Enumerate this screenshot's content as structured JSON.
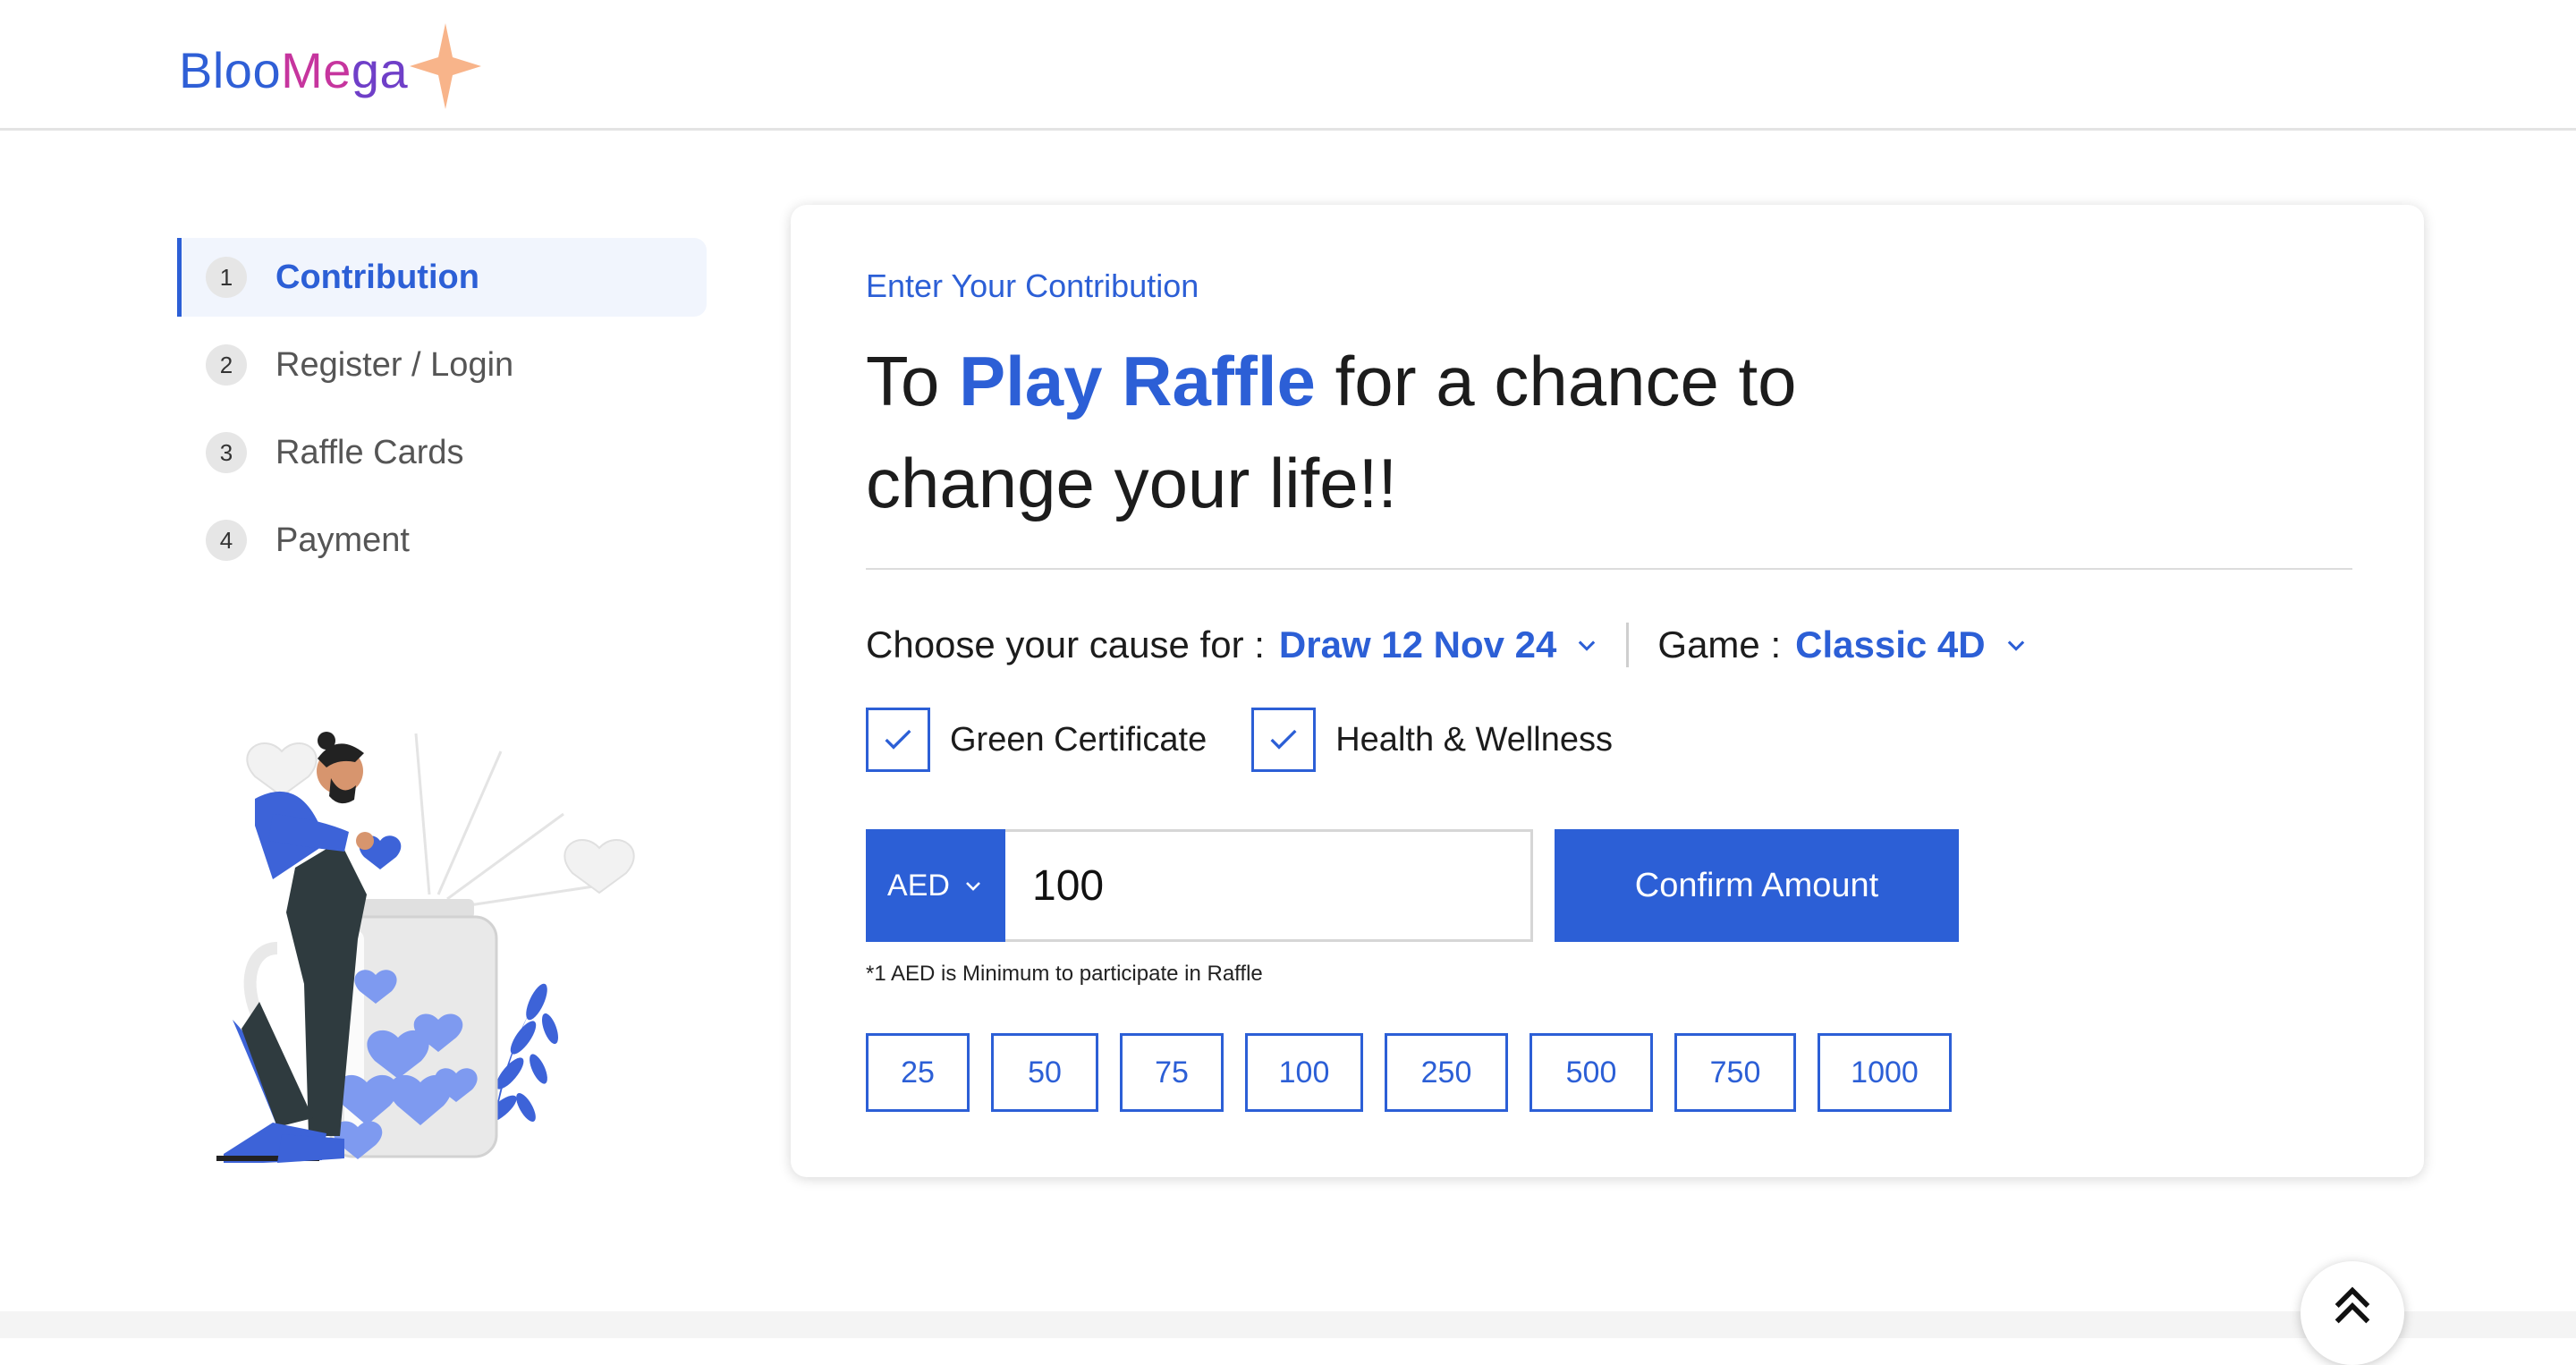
{
  "brand": {
    "part1": "Bloo",
    "part2": "Me",
    "part3": "ga"
  },
  "steps": [
    {
      "num": "1",
      "label": "Contribution",
      "active": true
    },
    {
      "num": "2",
      "label": "Register / Login",
      "active": false
    },
    {
      "num": "3",
      "label": "Raffle Cards",
      "active": false
    },
    {
      "num": "4",
      "label": "Payment",
      "active": false
    }
  ],
  "card": {
    "subtitle": "Enter Your Contribution",
    "title_pre": "To ",
    "title_accent": "Play Raffle",
    "title_post": " for a chance to change your life!!",
    "cause_label": "Choose your cause for :",
    "cause_value": "Draw 12 Nov 24",
    "game_label": "Game :",
    "game_value": "Classic 4D",
    "checkboxes": [
      {
        "label": "Green Certificate",
        "checked": true
      },
      {
        "label": "Health & Wellness",
        "checked": true
      }
    ],
    "currency": "AED",
    "amount": "100",
    "confirm_label": "Confirm Amount",
    "note": "*1 AED is Minimum to participate in Raffle",
    "presets": [
      "25",
      "50",
      "75",
      "100",
      "250",
      "500",
      "750",
      "1000"
    ]
  },
  "icons": {
    "step_active": "contribution-step",
    "chevron": "chevron-down-icon",
    "check": "check-icon",
    "scroll_top": "double-chevron-up-icon"
  },
  "colors": {
    "accent": "#2c5fd6",
    "brand_pink": "#c6359e",
    "star": "#f8b48a"
  }
}
